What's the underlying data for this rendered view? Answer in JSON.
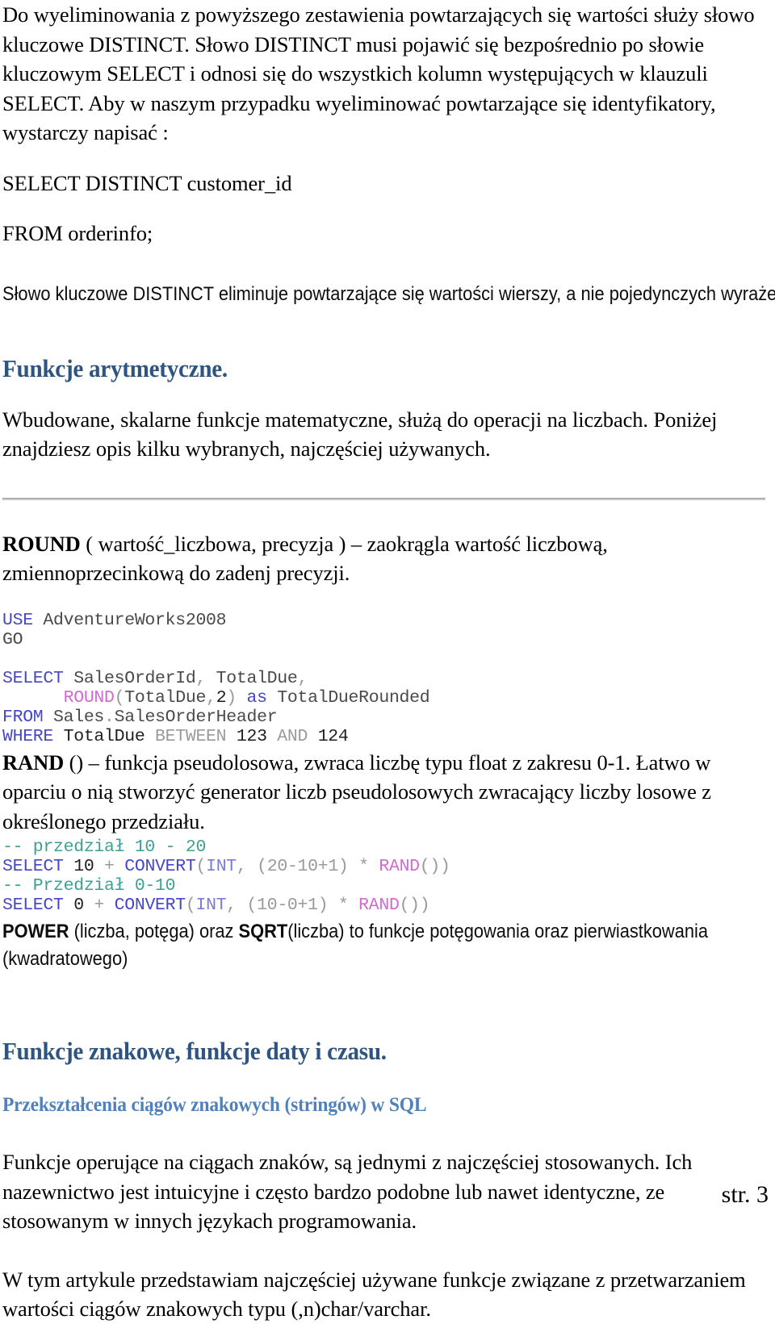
{
  "document": {
    "page_label": "str. 3",
    "colors": {
      "heading_main": "#2e5481",
      "heading_sub": "#4f81bd",
      "code_keyword": "#4646c8",
      "code_function": "#d16ad1",
      "code_comment": "#3f9f93",
      "code_operator": "#9a9a9a",
      "rule": "#9b9b9b"
    }
  },
  "intro": {
    "paragraph": "Do wyeliminowania z powyższego zestawienia powtarzających się wartości służy słowo kluczowe DISTINCT. Słowo DISTINCT musi pojawić się bezpośrednio po słowie kluczowym SELECT i odnosi się do wszystkich kolumn występujących w klauzuli SELECT. Aby w naszym przypadku wyeliminować powtarzające się identyfikatory, wystarczy napisać :",
    "query_line_1": "SELECT DISTINCT customer_id",
    "query_line_2": "FROM orderinfo;",
    "note": "Słowo kluczowe DISTINCT eliminuje powtarzające się wartości wierszy, a nie pojedynczych wyrażeń."
  },
  "arithmetic": {
    "heading": "Funkcje arytmetyczne.",
    "paragraph": "Wbudowane, skalarne funkcje matematyczne, służą do operacji na liczbach. Poniżej znajdziesz opis kilku wybranych, najczęściej używanych."
  },
  "round": {
    "name": "ROUND",
    "signature_and_desc": " ( wartość_liczbowa, precyzja ) – zaokrągla wartość liczbową, zmiennoprzecinkową do zadenj precyzji.",
    "code": [
      {
        "tokens": [
          {
            "t": "USE",
            "c": "kw"
          },
          {
            "t": " AdventureWorks2008",
            "c": "id"
          }
        ]
      },
      {
        "tokens": [
          {
            "t": "GO",
            "c": "id"
          }
        ]
      },
      {
        "tokens": [
          {
            "t": "",
            "c": "id"
          }
        ]
      },
      {
        "tokens": [
          {
            "t": "SELECT",
            "c": "kw"
          },
          {
            "t": " SalesOrderId",
            "c": "id"
          },
          {
            "t": ",",
            "c": "op"
          },
          {
            "t": " TotalDue",
            "c": "id"
          },
          {
            "t": ",",
            "c": "op"
          }
        ]
      },
      {
        "tokens": [
          {
            "t": "      ",
            "c": "id"
          },
          {
            "t": "ROUND",
            "c": "fn"
          },
          {
            "t": "(",
            "c": "op"
          },
          {
            "t": "TotalDue",
            "c": "id"
          },
          {
            "t": ",",
            "c": "op"
          },
          {
            "t": "2",
            "c": "num"
          },
          {
            "t": ")",
            "c": "op"
          },
          {
            "t": " as",
            "c": "kw"
          },
          {
            "t": " TotalDueRounded",
            "c": "id"
          }
        ]
      },
      {
        "tokens": [
          {
            "t": "FROM",
            "c": "kw"
          },
          {
            "t": " Sales",
            "c": "id"
          },
          {
            "t": ".",
            "c": "op"
          },
          {
            "t": "SalesOrderHeader",
            "c": "id"
          }
        ]
      },
      {
        "tokens": [
          {
            "t": "WHERE",
            "c": "kw"
          },
          {
            "t": " TotalDue ",
            "c": "num"
          },
          {
            "t": "BETWEEN",
            "c": "op"
          },
          {
            "t": " 123 ",
            "c": "num"
          },
          {
            "t": "AND",
            "c": "op"
          },
          {
            "t": " 124",
            "c": "num"
          }
        ]
      }
    ]
  },
  "rand": {
    "name": "RAND",
    "signature_and_desc": " () – funkcja pseudolosowa, zwraca liczbę typu float z zakresu 0-1. Łatwo w oparciu o nią stworzyć generator liczb pseudolosowych zwracający liczby losowe z określonego przedziału.",
    "code": [
      {
        "tokens": [
          {
            "t": "-- przedział 10 - 20",
            "c": "cmt"
          }
        ]
      },
      {
        "tokens": [
          {
            "t": "SELECT",
            "c": "kw"
          },
          {
            "t": " 10 ",
            "c": "num"
          },
          {
            "t": "+",
            "c": "op"
          },
          {
            "t": " CONVERT",
            "c": "kw"
          },
          {
            "t": "(",
            "c": "op"
          },
          {
            "t": "INT",
            "c": "kw2"
          },
          {
            "t": ",",
            "c": "op"
          },
          {
            "t": " (20-10+1)",
            "c": "op"
          },
          {
            "t": " *",
            "c": "op"
          },
          {
            "t": " RAND",
            "c": "fn"
          },
          {
            "t": "())",
            "c": "op"
          }
        ]
      },
      {
        "tokens": [
          {
            "t": "-- Przedział 0-10",
            "c": "cmt"
          }
        ]
      },
      {
        "tokens": [
          {
            "t": "SELECT",
            "c": "kw"
          },
          {
            "t": " 0 ",
            "c": "num"
          },
          {
            "t": "+",
            "c": "op"
          },
          {
            "t": " CONVERT",
            "c": "kw"
          },
          {
            "t": "(",
            "c": "op"
          },
          {
            "t": "INT",
            "c": "kw2"
          },
          {
            "t": ",",
            "c": "op"
          },
          {
            "t": " (10-0+1)",
            "c": "op"
          },
          {
            "t": " *",
            "c": "op"
          },
          {
            "t": " RAND",
            "c": "fn"
          },
          {
            "t": "())",
            "c": "op"
          }
        ]
      }
    ]
  },
  "power": {
    "line_1_part_1": "POWER",
    "line_1_part_2": " (liczba, potęga) oraz ",
    "line_1_part_3": "SQRT",
    "line_1_part_4": "(liczba) to funkcje potęgowania oraz pierwiastkowania",
    "line_2": "(kwadratowego)"
  },
  "strings": {
    "heading": "Funkcje znakowe, funkcje daty i czasu.",
    "subheading": "Przekształcenia ciągów znakowych (stringów) w SQL",
    "paragraph_1": "Funkcje operujące na ciągach znaków, są jednymi z najczęściej stosowanych. Ich nazewnictwo jest intuicyjne i często bardzo podobne lub nawet identyczne, ze stosowanym w innych językach programowania.",
    "paragraph_2": "W tym artykule przedstawiam najczęściej używane funkcje związane z przetwarzaniem wartości ciągów znakowych typu (,n)char/varchar."
  }
}
